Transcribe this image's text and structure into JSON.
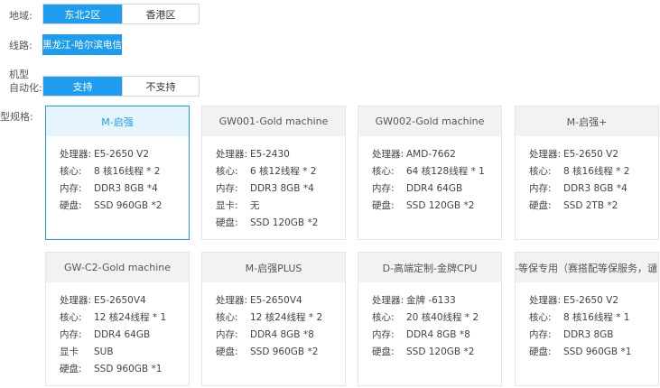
{
  "region": {
    "label": "地域:",
    "options": [
      "东北2区",
      "香港区"
    ],
    "selected": 0
  },
  "line": {
    "label": "线路:",
    "value": "黑龙江-哈尔滨电信"
  },
  "automation": {
    "label_line1": "机型",
    "label_line2": "自动化:",
    "options": [
      "支持",
      "不支持"
    ],
    "selected": 0
  },
  "model": {
    "label": "型规格:"
  },
  "cards": [
    {
      "title": "M-启强",
      "specs": [
        [
          "处理器:",
          "E5-2650 V2"
        ],
        [
          "核心:",
          "8 核16线程 * 2"
        ],
        [
          "内存:",
          "DDR3 8GB *4"
        ],
        [
          "硬盘:",
          "SSD 960GB *2"
        ]
      ]
    },
    {
      "title": "GW001-Gold machine",
      "specs": [
        [
          "处理器:",
          "E5-2430"
        ],
        [
          "核心:",
          "6 核12线程 * 2"
        ],
        [
          "内存:",
          "DDR3 8GB *4"
        ],
        [
          "显卡:",
          "无"
        ],
        [
          "硬盘:",
          "SSD 120GB *2"
        ]
      ]
    },
    {
      "title": "GW002-Gold machine",
      "specs": [
        [
          "处理器:",
          "AMD-7662"
        ],
        [
          "核心:",
          "64 核128线程 * 1"
        ],
        [
          "内存:",
          "DDR4 64GB"
        ],
        [
          "硬盘:",
          "SSD 120GB *2"
        ]
      ]
    },
    {
      "title": "M-启强+",
      "specs": [
        [
          "处理器:",
          "E5-2650 V2"
        ],
        [
          "核心:",
          "8 核16线程 * 2"
        ],
        [
          "内存:",
          "DDR3 8GB *4"
        ],
        [
          "硬盘:",
          "SSD 2TB *2"
        ]
      ]
    },
    {
      "title": "GW-C2-Gold machine",
      "specs": [
        [
          "处理器:",
          "E5-2650V4"
        ],
        [
          "核心:",
          "12 核24线程 * 1"
        ],
        [
          "内存:",
          "DDR4 64GB"
        ],
        [
          "显卡",
          "SUB"
        ],
        [
          "硬盘:",
          "SSD 960GB *1"
        ]
      ]
    },
    {
      "title": "M-启强PLUS",
      "specs": [
        [
          "处理器:",
          "E5-2650V4"
        ],
        [
          "核心:",
          "12 核24线程 * 2"
        ],
        [
          "内存:",
          "DDR4 8GB *8"
        ],
        [
          "硬盘:",
          "SSD 960GB *2"
        ]
      ]
    },
    {
      "title": "D-高端定制-金牌CPU",
      "specs": [
        [
          "处理器:",
          "金牌 -6133"
        ],
        [
          "核心:",
          "20 核40线程 * 2"
        ],
        [
          "内存:",
          "DDR4 8GB *8"
        ],
        [
          "硬盘:",
          "SSD 120GB *2"
        ]
      ]
    },
    {
      "title": "D-等保专用（赛搭配等保服务，谴...",
      "specs": [
        [
          "处理器:",
          "E5-2650 V2"
        ],
        [
          "核心:",
          "8 核16线程 * 1"
        ],
        [
          "内存:",
          "DDR3 8GB"
        ],
        [
          "硬盘:",
          "SSD 960GB *1"
        ]
      ]
    }
  ],
  "selected_card": 0,
  "colors": {
    "accent": "#1e9cf0",
    "border": "#d9d9d9",
    "card_header": "#f2f2f2"
  }
}
